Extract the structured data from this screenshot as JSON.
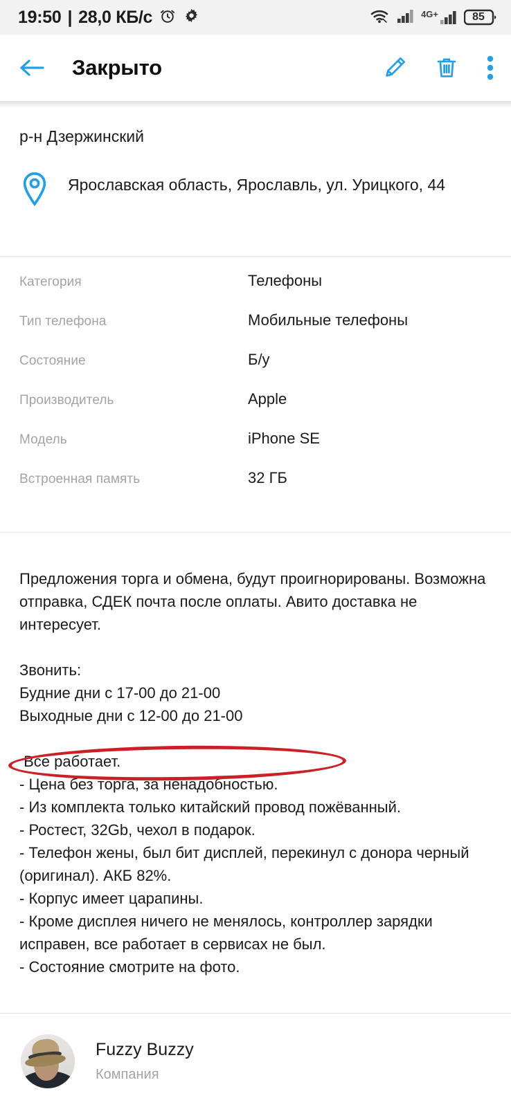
{
  "status_bar": {
    "time": "19:50",
    "separator": "|",
    "network_speed": "28,0 КБ/с",
    "alarm_icon": "alarm-clock-icon",
    "settings_icon": "gear-icon",
    "wifi_icon": "wifi-icon",
    "signal_icon": "signal-bars-icon",
    "network_type": "4G+",
    "battery_level": "85"
  },
  "app_bar": {
    "back_icon": "back-arrow-icon",
    "title": "Закрыто",
    "edit_icon": "pencil-icon",
    "delete_icon": "trash-icon",
    "overflow_icon": "more-vertical-icon"
  },
  "location": {
    "district": "р-н Дзержинский",
    "pin_icon": "location-pin-icon",
    "address": "Ярославская область, Ярославль, ул. Урицкого, 44"
  },
  "attributes": [
    {
      "label": "Категория",
      "value": "Телефоны"
    },
    {
      "label": "Тип телефона",
      "value": "Мобильные телефоны"
    },
    {
      "label": "Состояние",
      "value": "Б/у"
    },
    {
      "label": "Производитель",
      "value": "Apple"
    },
    {
      "label": "Модель",
      "value": "iPhone SE"
    },
    {
      "label": "Встроенная память",
      "value": "32 ГБ"
    }
  ],
  "description": {
    "text": "Предложения торга и обмена, будут проигнорированы. Возможна отправка, СДЕК почта после оплаты. Авито доставка не интересует.\n\nЗвонить:\nБудние дни с 17-00 до 21-00\nВыходные дни с 12-00 до 21-00\n\n Все работает.\n- Цена без торга, за ненадобностью.\n- Из комплекта только китайский провод пожёванный.\n- Ростест, 32Gb, чехол в подарок.\n- Телефон жены, был бит дисплей, перекинул с донора черный (оригинал). АКБ 82%.\n- Корпус имеет царапины.\n- Кроме дисплея ничего не менялось, контроллер зарядки исправен, все работает в сервисах не был.\n- Состояние смотрите на фото."
  },
  "annotation": {
    "shape": "ellipse",
    "color": "#cc2027",
    "targets_text": "- Цена без торга, за ненадобностью."
  },
  "seller": {
    "avatar_icon": "user-avatar-photo",
    "name": "Fuzzy Buzzy",
    "type": "Компания"
  },
  "colors": {
    "accent": "#21a0e8",
    "status_bar_bg": "#f2f2f2",
    "label_gray": "#a3a3a3",
    "text": "#1a1a1a",
    "annotation_red": "#cc2027"
  }
}
